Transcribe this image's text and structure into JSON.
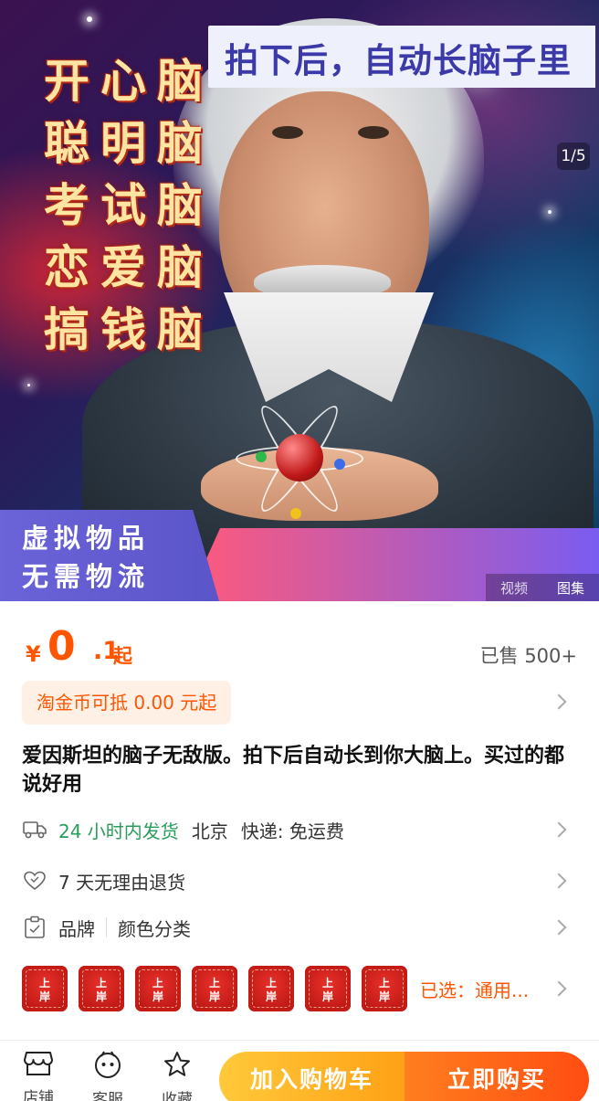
{
  "hero": {
    "lines": [
      "开心脑",
      "聪明脑",
      "考试脑",
      "恋爱脑",
      "搞钱脑"
    ],
    "page_indicator": "1/5",
    "banner_left": [
      "虚拟物品",
      "无需物流"
    ],
    "banner_right": "拍下后，自动长脑子里",
    "media_tabs": [
      "视频",
      "图集"
    ]
  },
  "price": {
    "currency": "¥",
    "integer": "0",
    "decimal": ".1",
    "suffix": "起",
    "sold": "已售 500+"
  },
  "coin": {
    "label": "淘金币可抵 0.00 元起"
  },
  "product": {
    "title": "爱因斯坦的脑子无敌版。拍下后自动长到你大脑上。买过的都说好用"
  },
  "shipping": {
    "icon": "truck-icon",
    "time": "24 小时内发货",
    "origin": "北京",
    "express": "快递: 免运费"
  },
  "returns": {
    "icon": "heart-icon",
    "label": "7 天无理由退货"
  },
  "params": {
    "icon": "clipboard-icon",
    "brand": "品牌",
    "color_class": "颜色分类"
  },
  "sku": {
    "thumb_text": [
      "上",
      "岸"
    ],
    "thumb_count": 7,
    "selected": "已选：通用..."
  },
  "bottom_bar": {
    "store": "店铺",
    "service": "客服",
    "favorite": "收藏",
    "add_to_cart": "加入购物车",
    "buy_now": "立即购买"
  },
  "colors": {
    "accent_orange": "#ff5500",
    "green": "#2a9d5c",
    "cart_button": "#ffa116",
    "buy_button": "#ff4d12"
  }
}
